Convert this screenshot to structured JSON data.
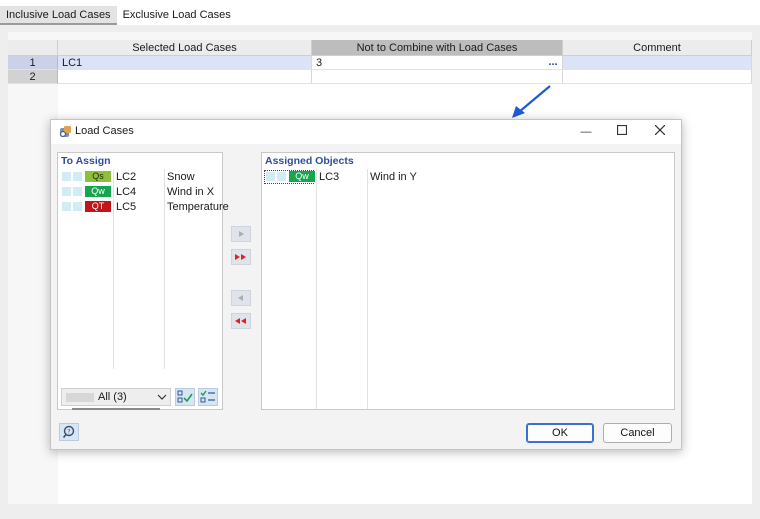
{
  "tabs": [
    {
      "label": "Inclusive Load Cases",
      "active": true
    },
    {
      "label": "Exclusive Load Cases",
      "active": false
    }
  ],
  "grid": {
    "columns": [
      "Selected Load Cases",
      "Not to Combine with Load Cases",
      "Comment"
    ],
    "rows": [
      {
        "num": "1",
        "selected": "LC1",
        "not_combine": "3",
        "comment": ""
      },
      {
        "num": "2",
        "selected": "",
        "not_combine": "",
        "comment": ""
      }
    ],
    "ellipsis": "..."
  },
  "dialog": {
    "title": "Load Cases",
    "to_assign": {
      "title": "To Assign",
      "items": [
        {
          "badge": "Qs",
          "code": "LC2",
          "name": "Snow",
          "color": "#8dbf3a"
        },
        {
          "badge": "Qw",
          "code": "LC4",
          "name": "Wind in X",
          "color": "#18a550"
        },
        {
          "badge": "QT",
          "code": "LC5",
          "name": "Temperature",
          "color": "#c0161b"
        }
      ],
      "filter_label": "All (3)"
    },
    "assigned": {
      "title": "Assigned Objects",
      "items": [
        {
          "badge": "Qw",
          "code": "LC3",
          "name": "Wind in Y",
          "color": "#18a550"
        }
      ]
    },
    "ok_label": "OK",
    "cancel_label": "Cancel"
  },
  "colors": {
    "accent": "#2e4f9a",
    "arrow": "#1e5bd8",
    "move_red": "#e01f2b"
  }
}
